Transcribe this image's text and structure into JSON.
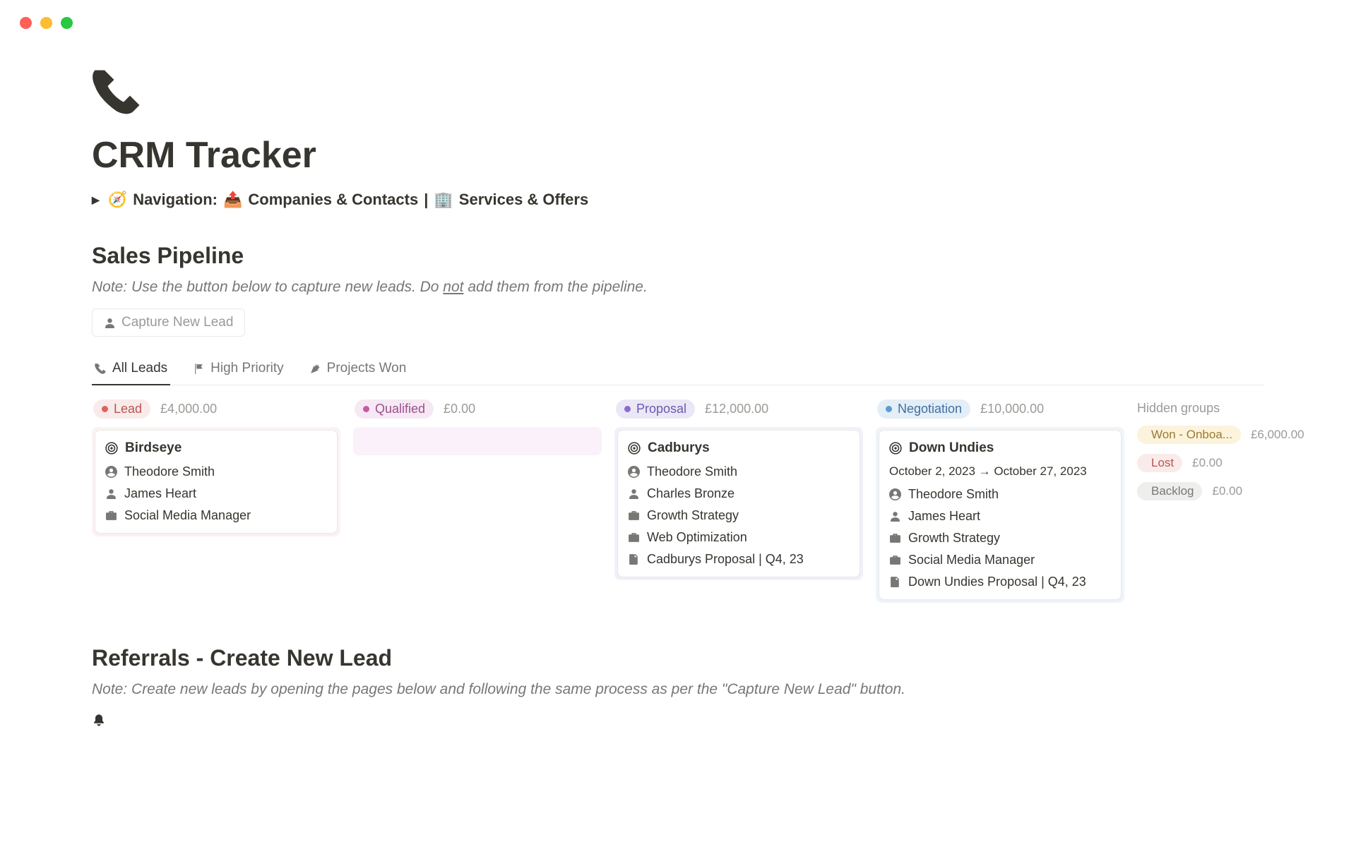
{
  "page": {
    "title": "CRM Tracker",
    "nav_label": "Navigation:",
    "nav_link1": "Companies & Contacts",
    "nav_sep": "|",
    "nav_link2": "Services & Offers"
  },
  "pipeline": {
    "heading": "Sales Pipeline",
    "note_pre": "Note: Use the button below to capture new leads. Do ",
    "note_under": "not",
    "note_post": " add them from the pipeline.",
    "capture_btn": "Capture New Lead"
  },
  "tabs": {
    "all_leads": "All Leads",
    "high_priority": "High Priority",
    "projects_won": "Projects Won"
  },
  "columns": [
    {
      "key": "lead",
      "label": "Lead",
      "amount": "£4,000.00",
      "card": {
        "title": "Birdseye",
        "lines": [
          {
            "icon": "user-circle",
            "text": "Theodore Smith"
          },
          {
            "icon": "person",
            "text": "James Heart"
          },
          {
            "icon": "briefcase",
            "text": "Social Media Manager"
          }
        ]
      }
    },
    {
      "key": "qualified",
      "label": "Qualified",
      "amount": "£0.00",
      "card": null
    },
    {
      "key": "proposal",
      "label": "Proposal",
      "amount": "£12,000.00",
      "card": {
        "title": "Cadburys",
        "lines": [
          {
            "icon": "user-circle",
            "text": "Theodore Smith"
          },
          {
            "icon": "person",
            "text": "Charles Bronze"
          },
          {
            "icon": "briefcase",
            "text": "Growth Strategy"
          },
          {
            "icon": "briefcase",
            "text": "Web Optimization"
          },
          {
            "icon": "file",
            "text": "Cadburys Proposal | Q4, 23"
          }
        ]
      }
    },
    {
      "key": "negotiation",
      "label": "Negotiation",
      "amount": "£10,000.00",
      "card": {
        "title": "Down Undies",
        "date": "October 2, 2023 → October 27, 2023",
        "lines": [
          {
            "icon": "user-circle",
            "text": "Theodore Smith"
          },
          {
            "icon": "person",
            "text": "James Heart"
          },
          {
            "icon": "briefcase",
            "text": "Growth Strategy"
          },
          {
            "icon": "briefcase",
            "text": "Social Media Manager"
          },
          {
            "icon": "file",
            "text": "Down Undies Proposal | Q4, 23"
          }
        ]
      }
    }
  ],
  "hidden": {
    "heading": "Hidden groups",
    "groups": [
      {
        "key": "won",
        "label": "Won - Onboa...",
        "amount": "£6,000.00"
      },
      {
        "key": "lost",
        "label": "Lost",
        "amount": "£0.00"
      },
      {
        "key": "backlog",
        "label": "Backlog",
        "amount": "£0.00"
      }
    ]
  },
  "referrals": {
    "heading": "Referrals - Create New Lead",
    "note": "Note: Create new leads by opening the pages below and following the same process as per the \"Capture New Lead\" button."
  }
}
